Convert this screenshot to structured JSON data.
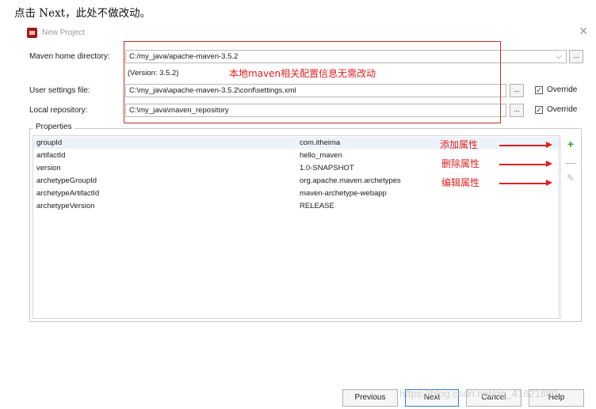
{
  "doc_instruction": "点击 Next，此处不做改动。",
  "window": {
    "title": "New Project"
  },
  "form": {
    "maven_home_label": "Maven home directory:",
    "maven_home_value": "C:/my_java/apache-maven-3.5.2",
    "version_text": "(Version: 3.5.2)",
    "user_settings_label": "User settings file:",
    "user_settings_value": "C:\\my_java\\apache-maven-3.5.2\\conf\\settings.xml",
    "local_repo_label": "Local repository:",
    "local_repo_value": "C:\\my_java\\maven_repository",
    "browse_label": "...",
    "override_label": "Override",
    "override_checked": "✓"
  },
  "annotations": {
    "no_change_note": "本地maven相关配置信息无需改动",
    "add_note": "添加属性",
    "delete_note": "删除属性",
    "edit_note": "编辑属性",
    "color": "#e02020"
  },
  "properties": {
    "title": "Properties",
    "rows": [
      {
        "key": "groupId",
        "value": "com.itheima"
      },
      {
        "key": "artifactId",
        "value": "hello_maven"
      },
      {
        "key": "version",
        "value": "1.0-SNAPSHOT"
      },
      {
        "key": "archetypeGroupId",
        "value": "org.apache.maven.archetypes"
      },
      {
        "key": "archetypeArtifactId",
        "value": "maven-archetype-webapp"
      },
      {
        "key": "archetypeVersion",
        "value": "RELEASE"
      }
    ],
    "tools": {
      "add": "+",
      "remove": "—",
      "edit": "✎"
    }
  },
  "footer": {
    "previous": "Previous",
    "next": "Next",
    "cancel": "Cancel",
    "help": "Help"
  },
  "watermark": "https://blog.csdn.net/qq_41621880"
}
